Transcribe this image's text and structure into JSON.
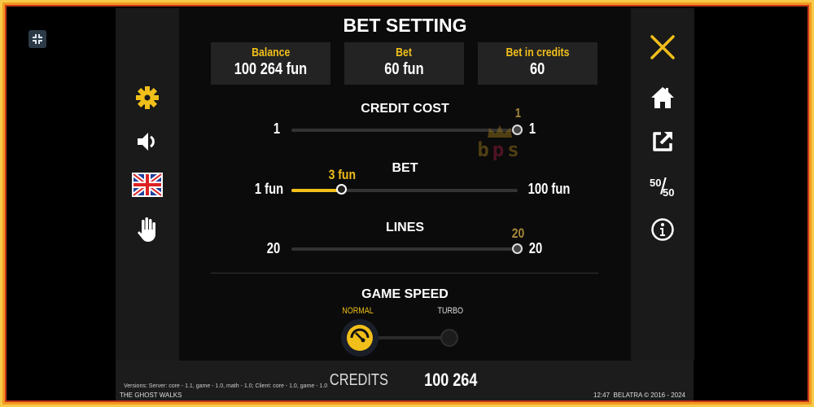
{
  "title": "BET SETTING",
  "summary": [
    {
      "label": "Balance",
      "value": "100 264 fun"
    },
    {
      "label": "Bet",
      "value": "60 fun"
    },
    {
      "label": "Bet in credits",
      "value": "60"
    }
  ],
  "credit_cost": {
    "label": "CREDIT COST",
    "min": "1",
    "max": "1",
    "current": "1",
    "fraction": 1.0
  },
  "bet": {
    "label": "BET",
    "min": "1 fun",
    "max": "100 fun",
    "current": "3 fun",
    "fraction": 0.22
  },
  "lines": {
    "label": "LINES",
    "min": "20",
    "max": "20",
    "current": "20",
    "fraction": 1.0
  },
  "game_speed": {
    "label": "GAME SPEED",
    "options": [
      "NORMAL",
      "TURBO"
    ],
    "selected": "NORMAL"
  },
  "left_icons": [
    "gear-icon",
    "sound-icon",
    "uk-flag-icon",
    "hand-icon"
  ],
  "right_icons": [
    "close-icon",
    "home-icon",
    "external-link-icon",
    "fifty-fifty-icon",
    "info-icon"
  ],
  "fifty": {
    "top": "50",
    "bottom": "50"
  },
  "watermark": "bps",
  "footer": {
    "versions": "Versions: Server: core - 1.1, game - 1.0, math - 1.0; Client: core - 1.0, game - 1.0",
    "game_name": "THE GHOST WALKS",
    "credits_label": "CREDITS",
    "credits_value": "100 264",
    "time": "12:47",
    "copyright": "BELATRA © 2016 - 2024"
  },
  "colors": {
    "accent": "#f1bf1a",
    "panel": "#1a1a1a",
    "frame": "#f29a1f"
  }
}
